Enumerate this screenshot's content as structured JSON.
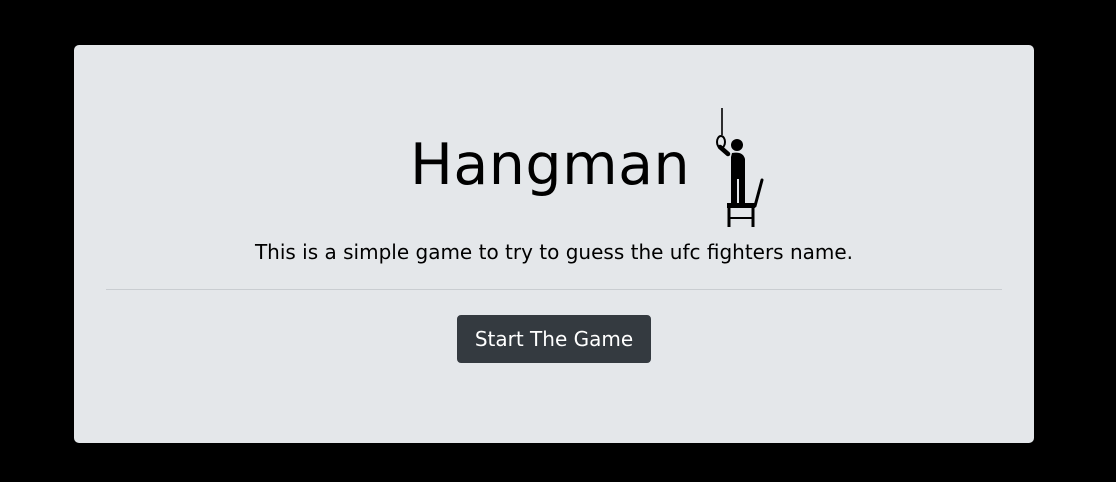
{
  "header": {
    "title": "Hangman",
    "icon": "hangman-icon"
  },
  "intro": {
    "text": "This is a simple game to try to guess the ufc fighters name."
  },
  "actions": {
    "start_label": "Start The Game"
  },
  "colors": {
    "page_background": "#000000",
    "panel_background": "#e4e7ea",
    "button_background": "#343a40",
    "button_text": "#ffffff",
    "text": "#000000"
  }
}
